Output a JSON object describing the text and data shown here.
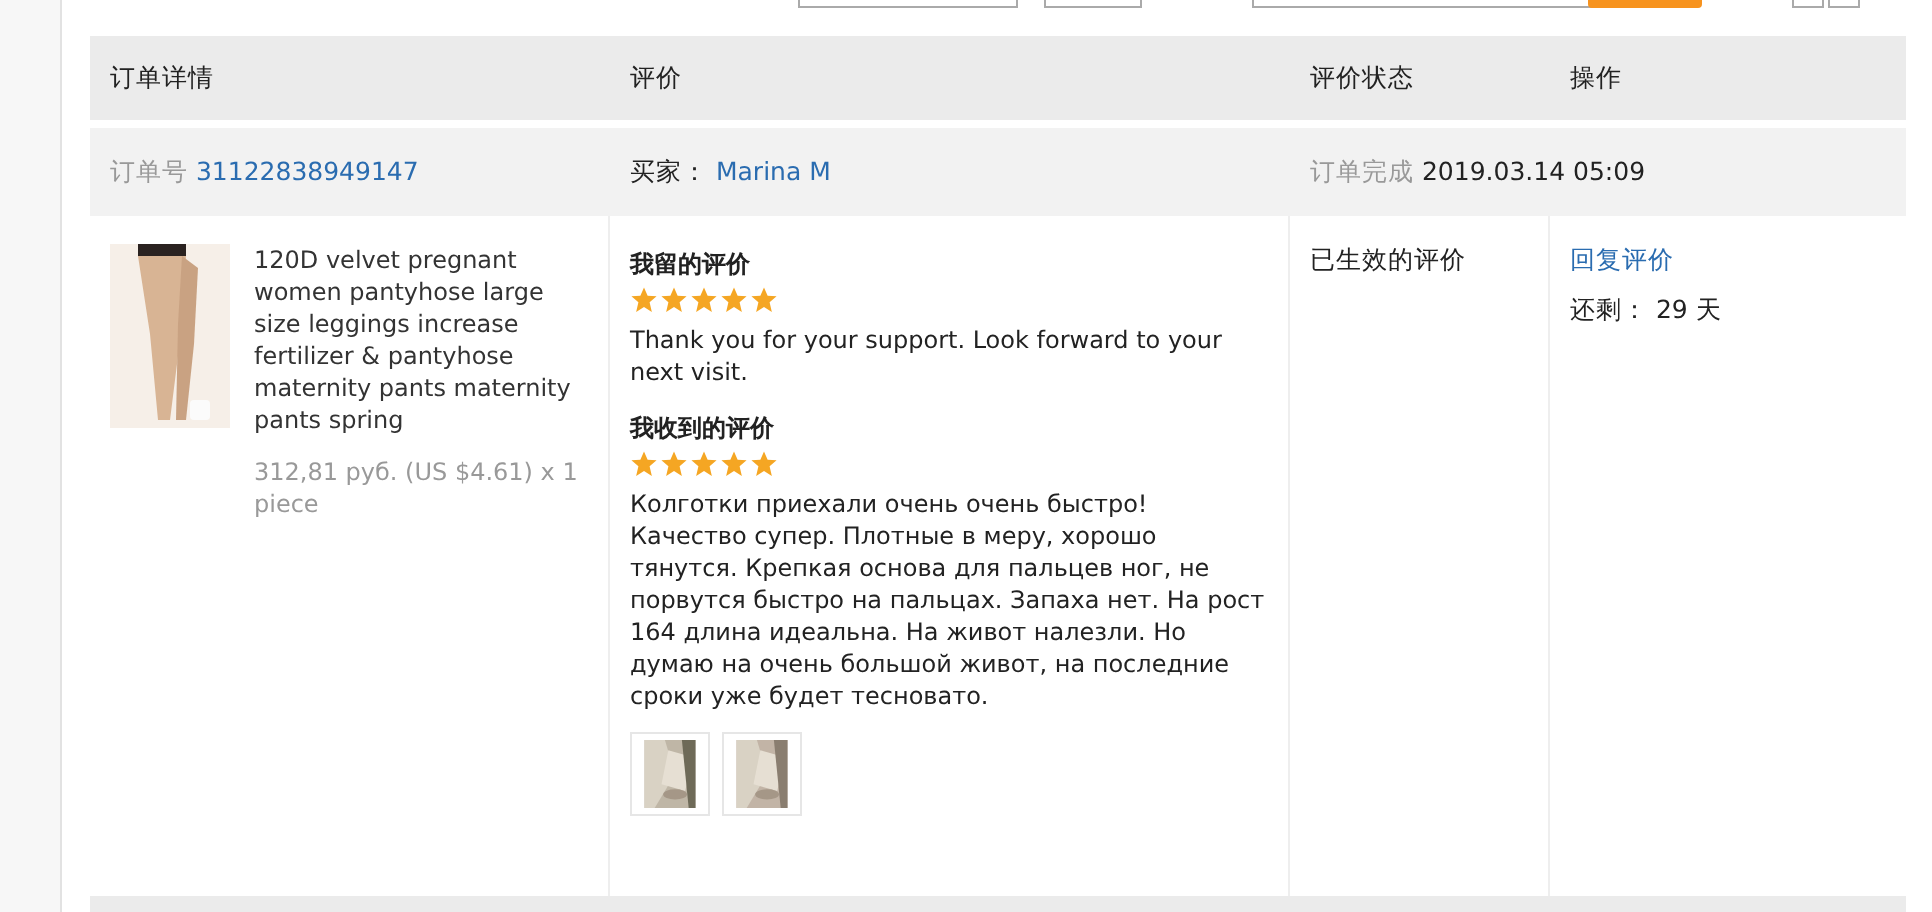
{
  "table": {
    "columns": [
      "订单详情",
      "评价",
      "评价状态",
      "操作"
    ],
    "order": {
      "number_label": "订单号",
      "number": "31122838949147",
      "buyer_label": "买家：",
      "buyer": "Marina M",
      "status_label": "订单完成",
      "completed_at": "2019.03.14 05:09"
    },
    "item": {
      "product": {
        "kind": "picture",
        "title": "120D velvet pregnant women pantyhose large size leggings increase fertilizer & pantyhose maternity pants maternity pants spring",
        "price": "312,81 руб. (US $4.61) x 1 piece"
      },
      "reviews": [
        {
          "heading": "我留的评价",
          "stars": 5,
          "text": "Thank you for your support. Look forward to your next visit."
        },
        {
          "heading": "我收到的评价",
          "stars": 5,
          "text": "Колготки приехали очень очень быстро! Качество супер. Плотные в меру, хорошо тянутся. Крепкая основа для пальцев ног, не порвутся быстро на пальцах. Запаха нет. На рост 164 длина идеальна. На живот налезли. Но думаю на очень большой живот, на последние сроки уже будет тесновато.",
          "photos": [
            {
              "kind": "picture"
            },
            {
              "kind": "picture"
            }
          ]
        }
      ],
      "status": "已生效的评价",
      "action": "回复评价",
      "remaining_label": "还剩：",
      "remaining": "29 天"
    }
  }
}
